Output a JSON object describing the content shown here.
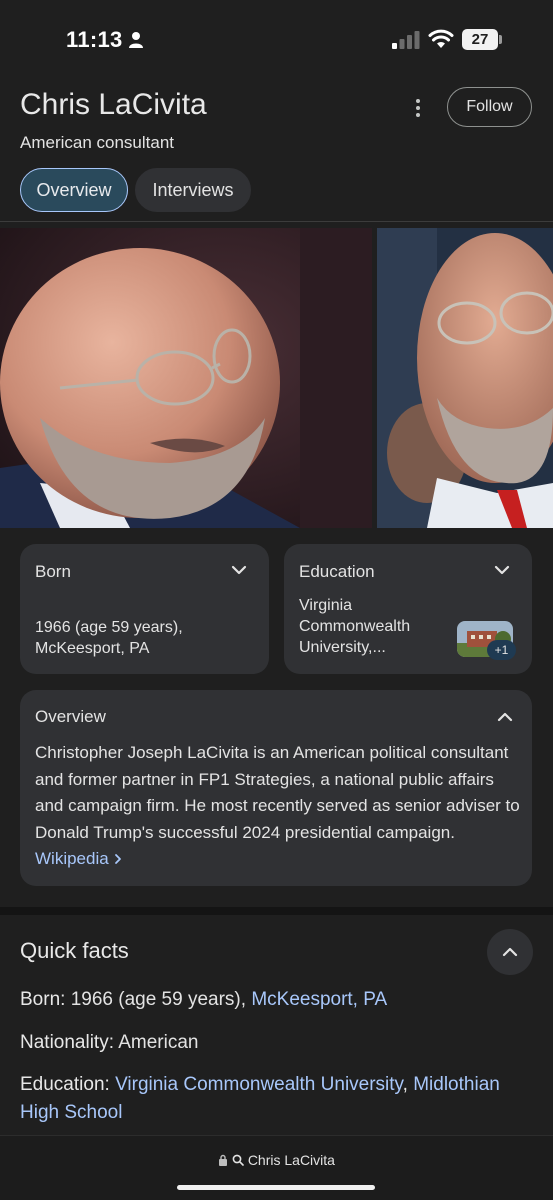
{
  "status_bar": {
    "time": "11:13",
    "battery": "27",
    "icons": [
      "person-icon",
      "signal-icon",
      "wifi-icon",
      "battery-icon"
    ]
  },
  "header": {
    "title": "Chris LaCivita",
    "subtitle": "American consultant",
    "follow_label": "Follow",
    "tabs": [
      {
        "label": "Overview",
        "selected": true
      },
      {
        "label": "Interviews",
        "selected": false
      }
    ]
  },
  "cards": {
    "born": {
      "title": "Born",
      "value": "1966 (age 59 years), McKeesport, PA"
    },
    "education": {
      "title": "Education",
      "value": "Virginia Commonwealth University,...",
      "extra_count": "+1"
    }
  },
  "overview": {
    "title": "Overview",
    "text": "Christopher Joseph LaCivita is an American political consultant and former partner in FP1 Strategies, a national public affairs and campaign firm. He most recently served as senior adviser to Donald Trump's successful 2024 presidential campaign. ",
    "source_link": "Wikipedia"
  },
  "quick_facts": {
    "title": "Quick facts",
    "born_label": "Born",
    "born_value": " 1966 (age 59 years), ",
    "born_link": "McKeesport, PA",
    "nationality_label": "Nationality",
    "nationality_value": " American",
    "education_label": "Education",
    "education_link_1": "Virginia Commonwealth University",
    "education_sep": ",",
    "education_link_2": "Midlothian High School"
  },
  "bottom_bar": {
    "url_text": "Chris LaCivita"
  },
  "colors": {
    "background": "#1f1f1f",
    "card": "#303134",
    "link": "#a8c7fa",
    "selected_tab_bg": "#2a4a5c"
  }
}
